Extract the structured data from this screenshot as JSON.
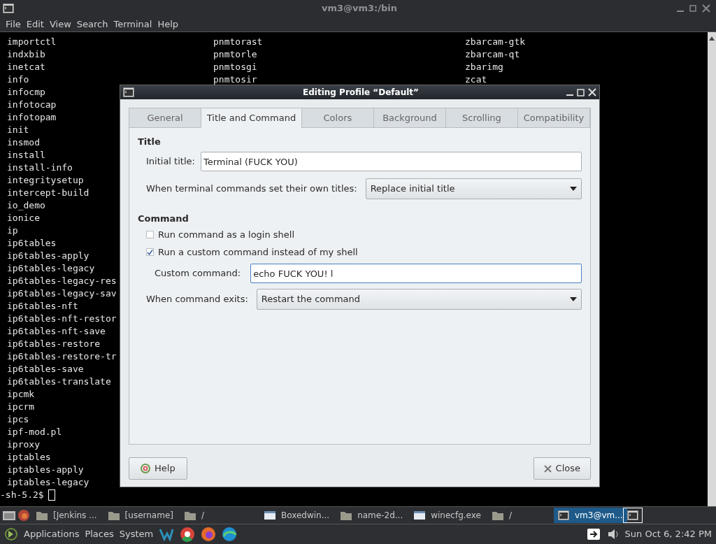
{
  "window": {
    "title": "vm3@vm3:/bin"
  },
  "menu": [
    "File",
    "Edit",
    "View",
    "Search",
    "Terminal",
    "Help"
  ],
  "terminal": {
    "rows": [
      [
        "importctl",
        "pnmtorast",
        "zbarcam-gtk"
      ],
      [
        "indxbib",
        "pnmtorle",
        "zbarcam-qt"
      ],
      [
        "inetcat",
        "pnmtosgi",
        "zbarimg"
      ],
      [
        "info",
        "pnmtosir",
        "zcat"
      ],
      [
        "infocmp"
      ],
      [
        "infotocap"
      ],
      [
        "infotopam"
      ],
      [
        "init"
      ],
      [
        "insmod"
      ],
      [
        "install"
      ],
      [
        "install-info"
      ],
      [
        "integritysetup"
      ],
      [
        "intercept-build"
      ],
      [
        "io_demo"
      ],
      [
        "ionice"
      ],
      [
        "ip"
      ],
      [
        "ip6tables"
      ],
      [
        "ip6tables-apply"
      ],
      [
        "ip6tables-legacy"
      ],
      [
        "ip6tables-legacy-res"
      ],
      [
        "ip6tables-legacy-sav"
      ],
      [
        "ip6tables-nft"
      ],
      [
        "ip6tables-nft-restor"
      ],
      [
        "ip6tables-nft-save"
      ],
      [
        "ip6tables-restore"
      ],
      [
        "ip6tables-restore-tr"
      ],
      [
        "ip6tables-save"
      ],
      [
        "ip6tables-translate"
      ],
      [
        "ipcmk"
      ],
      [
        "ipcrm"
      ],
      [
        "ipcs"
      ],
      [
        "ipf-mod.pl"
      ],
      [
        "iproxy"
      ],
      [
        "iptables"
      ],
      [
        "iptables-apply"
      ],
      [
        "iptables-legacy"
      ]
    ],
    "prompt": "-sh-5.2$"
  },
  "dialog": {
    "title": "Editing Profile “Default”",
    "tabs": [
      {
        "label": "General",
        "selected": false
      },
      {
        "label": "Title and Command",
        "selected": true
      },
      {
        "label": "Colors",
        "selected": false
      },
      {
        "label": "Background",
        "selected": false
      },
      {
        "label": "Scrolling",
        "selected": false
      },
      {
        "label": "Compatibility",
        "selected": false
      }
    ],
    "title_section": {
      "heading": "Title",
      "initial_title_label": "Initial title:",
      "initial_title": "Terminal (FUCK YOU)",
      "set_titles_label": "When terminal commands set their own titles:",
      "set_titles_value": "Replace initial title"
    },
    "command_section": {
      "heading": "Command",
      "checkboxes": [
        {
          "label": "Run command as a login shell",
          "checked": false
        },
        {
          "label": "Run a custom command instead of my shell",
          "checked": true
        }
      ],
      "custom_command_label": "Custom command:",
      "custom_command": "echo FUCK YOU! l",
      "exits_label": "When command exits:",
      "exits_value": "Restart the command"
    },
    "help_button": "Help",
    "close_button": "Close"
  },
  "taskbar": [
    {
      "kind": "folder",
      "label": "[Jenkins ...",
      "selected": false
    },
    {
      "kind": "folder",
      "label": "[username]",
      "selected": false
    },
    {
      "kind": "folder",
      "label": "/",
      "selected": false
    },
    {
      "kind": "window",
      "label": "Boxedwin...",
      "selected": false
    },
    {
      "kind": "folder",
      "label": "name-2d...",
      "selected": false
    },
    {
      "kind": "window",
      "label": "winecfg.exe",
      "selected": false
    },
    {
      "kind": "folder",
      "label": "/",
      "selected": false
    },
    {
      "kind": "terminal",
      "label": "vm3@vm...",
      "selected": true
    }
  ],
  "panel": {
    "menus": [
      "Applications",
      "Places",
      "System"
    ],
    "clock": "Sun Oct 6, 2:42 PM"
  }
}
